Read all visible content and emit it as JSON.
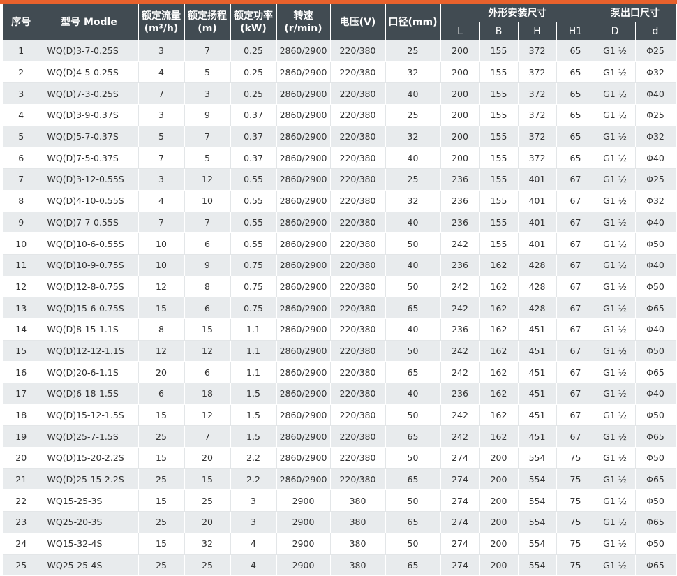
{
  "colors": {
    "accent": "#e8612c",
    "header_bg": "#414b52",
    "row_alt": "#e8ebed"
  },
  "headers": {
    "index": "序号",
    "model": "型号 Modle",
    "flow_l1": "额定流量",
    "flow_l2": "(m³/h)",
    "head_l1": "额定扬程",
    "head_l2": "(m)",
    "power_l1": "额定功率",
    "power_l2": "(kW)",
    "speed_l1": "转速",
    "speed_l2": "(r/min)",
    "voltage": "电压(V)",
    "caliber": "口径(mm)",
    "dims": "外形安装尺寸",
    "outlet": "泵出口尺寸",
    "L": "L",
    "B": "B",
    "H": "H",
    "H1": "H1",
    "D": "D",
    "d": "d"
  },
  "rows": [
    [
      "1",
      "WQ(D)3-7-0.25S",
      "3",
      "7",
      "0.25",
      "2860/2900",
      "220/380",
      "25",
      "200",
      "155",
      "372",
      "65",
      "G1 ½",
      "Φ25"
    ],
    [
      "2",
      "WQ(D)4-5-0.25S",
      "4",
      "5",
      "0.25",
      "2860/2900",
      "220/380",
      "32",
      "200",
      "155",
      "372",
      "65",
      "G1 ½",
      "Φ32"
    ],
    [
      "3",
      "WQ(D)7-3-0.25S",
      "7",
      "3",
      "0.25",
      "2860/2900",
      "220/380",
      "40",
      "200",
      "155",
      "372",
      "65",
      "G1 ½",
      "Φ40"
    ],
    [
      "4",
      "WQ(D)3-9-0.37S",
      "3",
      "9",
      "0.37",
      "2860/2900",
      "220/380",
      "25",
      "200",
      "155",
      "372",
      "65",
      "G1 ½",
      "Φ25"
    ],
    [
      "5",
      "WQ(D)5-7-0.37S",
      "5",
      "7",
      "0.37",
      "2860/2900",
      "220/380",
      "32",
      "200",
      "155",
      "372",
      "65",
      "G1 ½",
      "Φ32"
    ],
    [
      "6",
      "WQ(D)7-5-0.37S",
      "7",
      "5",
      "0.37",
      "2860/2900",
      "220/380",
      "40",
      "200",
      "155",
      "372",
      "65",
      "G1 ½",
      "Φ40"
    ],
    [
      "7",
      "WQ(D)3-12-0.55S",
      "3",
      "12",
      "0.55",
      "2860/2900",
      "220/380",
      "25",
      "236",
      "155",
      "401",
      "67",
      "G1 ½",
      "Φ25"
    ],
    [
      "8",
      "WQ(D)4-10-0.55S",
      "4",
      "10",
      "0.55",
      "2860/2900",
      "220/380",
      "32",
      "236",
      "155",
      "401",
      "67",
      "G1 ½",
      "Φ32"
    ],
    [
      "9",
      "WQ(D)7-7-0.55S",
      "7",
      "7",
      "0.55",
      "2860/2900",
      "220/380",
      "40",
      "236",
      "155",
      "401",
      "67",
      "G1 ½",
      "Φ40"
    ],
    [
      "10",
      "WQ(D)10-6-0.55S",
      "10",
      "6",
      "0.55",
      "2860/2900",
      "220/380",
      "50",
      "242",
      "155",
      "401",
      "67",
      "G1 ½",
      "Φ50"
    ],
    [
      "11",
      "WQ(D)10-9-0.75S",
      "10",
      "9",
      "0.75",
      "2860/2900",
      "220/380",
      "40",
      "236",
      "162",
      "428",
      "67",
      "G1 ½",
      "Φ40"
    ],
    [
      "12",
      "WQ(D)12-8-0.75S",
      "12",
      "8",
      "0.75",
      "2860/2900",
      "220/380",
      "50",
      "242",
      "162",
      "428",
      "67",
      "G1 ½",
      "Φ50"
    ],
    [
      "13",
      "WQ(D)15-6-0.75S",
      "15",
      "6",
      "0.75",
      "2860/2900",
      "220/380",
      "65",
      "242",
      "162",
      "428",
      "67",
      "G1 ½",
      "Φ65"
    ],
    [
      "14",
      "WQ(D)8-15-1.1S",
      "8",
      "15",
      "1.1",
      "2860/2900",
      "220/380",
      "40",
      "236",
      "162",
      "451",
      "67",
      "G1 ½",
      "Φ40"
    ],
    [
      "15",
      "WQ(D)12-12-1.1S",
      "12",
      "12",
      "1.1",
      "2860/2900",
      "220/380",
      "50",
      "242",
      "162",
      "451",
      "67",
      "G1 ½",
      "Φ50"
    ],
    [
      "16",
      "WQ(D)20-6-1.1S",
      "20",
      "6",
      "1.1",
      "2860/2900",
      "220/380",
      "65",
      "242",
      "162",
      "451",
      "67",
      "G1 ½",
      "Φ65"
    ],
    [
      "17",
      "WQ(D)6-18-1.5S",
      "6",
      "18",
      "1.5",
      "2860/2900",
      "220/380",
      "40",
      "236",
      "162",
      "451",
      "67",
      "G1 ½",
      "Φ40"
    ],
    [
      "18",
      "WQ(D)15-12-1.5S",
      "15",
      "12",
      "1.5",
      "2860/2900",
      "220/380",
      "50",
      "242",
      "162",
      "451",
      "67",
      "G1 ½",
      "Φ50"
    ],
    [
      "19",
      "WQ(D)25-7-1.5S",
      "25",
      "7",
      "1.5",
      "2860/2900",
      "220/380",
      "65",
      "242",
      "162",
      "451",
      "67",
      "G1 ½",
      "Φ65"
    ],
    [
      "20",
      "WQ(D)15-20-2.2S",
      "15",
      "20",
      "2.2",
      "2860/2900",
      "220/380",
      "50",
      "274",
      "200",
      "554",
      "75",
      "G1 ½",
      "Φ50"
    ],
    [
      "21",
      "WQ(D)25-15-2.2S",
      "25",
      "15",
      "2.2",
      "2860/2900",
      "220/380",
      "65",
      "274",
      "200",
      "554",
      "75",
      "G1 ½",
      "Φ65"
    ],
    [
      "22",
      "WQ15-25-3S",
      "15",
      "25",
      "3",
      "2900",
      "380",
      "50",
      "274",
      "200",
      "554",
      "75",
      "G1 ½",
      "Φ50"
    ],
    [
      "23",
      "WQ25-20-3S",
      "25",
      "20",
      "3",
      "2900",
      "380",
      "65",
      "274",
      "200",
      "554",
      "75",
      "G1 ½",
      "Φ65"
    ],
    [
      "24",
      "WQ15-32-4S",
      "15",
      "32",
      "4",
      "2900",
      "380",
      "50",
      "274",
      "200",
      "554",
      "75",
      "G1 ½",
      "Φ50"
    ],
    [
      "25",
      "WQ25-25-4S",
      "25",
      "25",
      "4",
      "2900",
      "380",
      "65",
      "274",
      "200",
      "554",
      "75",
      "G1 ½",
      "Φ65"
    ]
  ]
}
